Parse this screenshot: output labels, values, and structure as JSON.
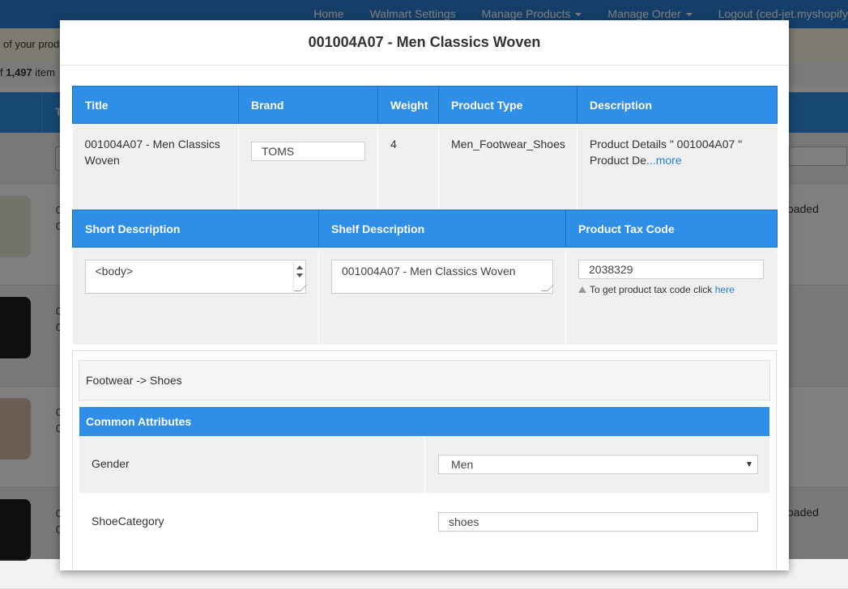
{
  "nav": {
    "items": [
      {
        "label": "Home",
        "has_caret": false
      },
      {
        "label": "Walmart Settings",
        "has_caret": false
      },
      {
        "label": "Manage Products",
        "has_caret": true
      },
      {
        "label": "Manage Order",
        "has_caret": true
      },
      {
        "label": "Logout (ced-jet.myshopify",
        "has_caret": false
      }
    ]
  },
  "background": {
    "notice_text": "of your prod",
    "count_prefix": "f ",
    "count_value": "1,497",
    "count_suffix": " item",
    "table_header_label": "T",
    "rows": [
      {
        "text_line1": "0",
        "text_line2": "0",
        "status": "oaded"
      },
      {
        "text_line1": "0",
        "text_line2": "0",
        "status": ""
      },
      {
        "text_line1": "0",
        "text_line2": "0",
        "status": ""
      },
      {
        "text_line1": "0",
        "text_line2": "0",
        "status": "oaded"
      }
    ]
  },
  "modal": {
    "title": "001004A07 - Men Classics Woven",
    "product_table": {
      "headers": [
        "Title",
        "Brand",
        "Weight",
        "Product Type",
        "Description"
      ],
      "title_value": "001004A07 - Men Classics Woven",
      "brand_value": "TOMS",
      "weight_value": "4",
      "product_type_value": "Men_Footwear_Shoes",
      "description_value": "Product Details \" 001004A07 \" Product De",
      "description_more": "...more"
    },
    "desc_table": {
      "headers": [
        "Short Description",
        "Shelf Description",
        "Product Tax Code"
      ],
      "short_description_value": "<body>",
      "shelf_description_value": "001004A07 - Men Classics Woven",
      "tax_code_value": "2038329",
      "tax_hint_text": "To get product tax code click ",
      "tax_hint_link": "here"
    },
    "category": {
      "breadcrumb": "Footwear -> Shoes",
      "section_title": "Common Attributes",
      "attributes": [
        {
          "label": "Gender",
          "type": "select",
          "value": "Men"
        },
        {
          "label": "ShoeCategory",
          "type": "input",
          "value": "shoes"
        }
      ]
    }
  },
  "colors": {
    "primary": "#2f8fe6",
    "navbar": "#2a7fd0",
    "link": "#2a7fd0",
    "cell_bg": "#f0f0f0"
  }
}
